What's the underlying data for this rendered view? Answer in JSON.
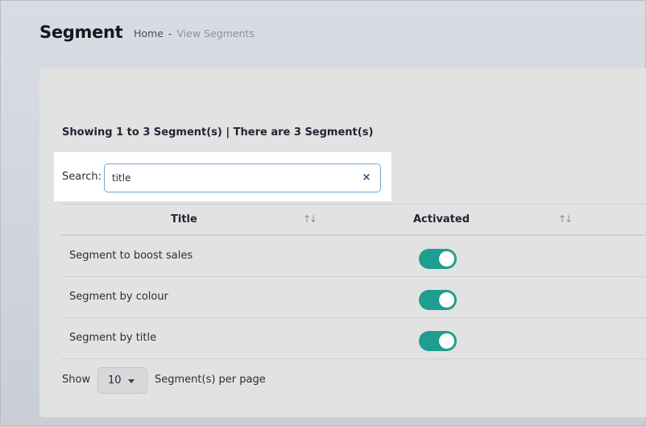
{
  "header": {
    "title": "Segment",
    "breadcrumb": {
      "home": "Home",
      "separator": "-",
      "current": "View Segments"
    }
  },
  "summary": "Showing 1 to 3 Segment(s) | There are 3 Segment(s)",
  "search": {
    "label": "Search:",
    "value": "title",
    "clear_icon": "×"
  },
  "table": {
    "columns": [
      "Title",
      "Activated"
    ],
    "sort_icon": "↑↓",
    "rows": [
      {
        "title": "Segment to boost sales",
        "activated": true
      },
      {
        "title": "Segment by colour",
        "activated": true
      },
      {
        "title": "Segment by title",
        "activated": true
      }
    ]
  },
  "pagination": {
    "show_label": "Show",
    "per_page_value": "10",
    "per_page_suffix": "Segment(s) per page"
  },
  "colors": {
    "toggle_on": "#1f9e8f",
    "input_focus_border": "#6da7d8"
  }
}
